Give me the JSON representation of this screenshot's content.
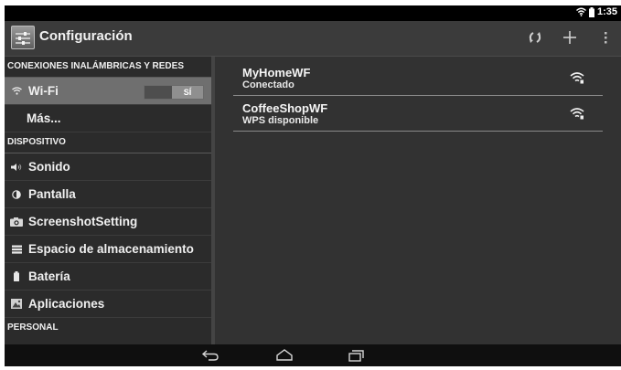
{
  "status_bar": {
    "time": "1:35"
  },
  "action_bar": {
    "title": "Configuración"
  },
  "sections": {
    "wireless": "CONEXIONES INALÁMBRICAS Y REDES",
    "device": "DISPOSITIVO",
    "personal": "PERSONAL"
  },
  "menu": {
    "wifi": {
      "label": "Wi-Fi",
      "toggle": "SÍ"
    },
    "more": "Más...",
    "sound": "Sonido",
    "display": "Pantalla",
    "screenshot": "ScreenshotSetting",
    "storage": "Espacio de almacenamiento",
    "battery": "Batería",
    "apps": "Aplicaciones"
  },
  "networks": [
    {
      "name": "MyHomeWF",
      "status": "Conectado"
    },
    {
      "name": "CoffeeShopWF",
      "status": "WPS disponible"
    }
  ],
  "icons": {
    "statusbar": [
      "wifi-icon",
      "battery-icon"
    ],
    "actionbar": [
      "settings-app-icon",
      "wps-icon",
      "add-icon",
      "overflow-menu-icon"
    ],
    "menu": [
      "wifi-icon",
      "sound-icon",
      "display-icon",
      "camera-icon",
      "storage-icon",
      "battery-icon",
      "apps-icon"
    ],
    "navbar": [
      "back-icon",
      "home-icon",
      "recents-icon"
    ]
  }
}
